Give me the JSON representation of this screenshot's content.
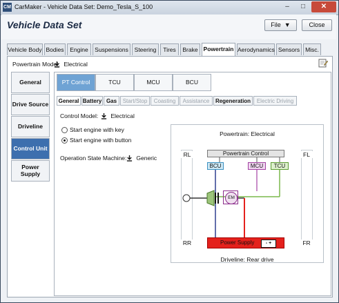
{
  "window": {
    "app_icon": "CM",
    "title": "CarMaker - Vehicle Data Set: Demo_Tesla_S_100",
    "minimize": "–",
    "maximize": "□",
    "close": "✕"
  },
  "header": {
    "title": "Vehicle Data Set",
    "file_label": "File",
    "close_label": "Close"
  },
  "main_tabs": [
    "Vehicle Body",
    "Bodies",
    "Engine",
    "Suspensions",
    "Steering",
    "Tires",
    "Brake",
    "Powertrain",
    "Aerodynamics",
    "Sensors",
    "Misc."
  ],
  "active_main_tab": "Powertrain",
  "powertrain": {
    "model_label": "Powertrain Model:",
    "model_value": "Electrical"
  },
  "sidebar": [
    {
      "label": "General"
    },
    {
      "label": "Drive Source"
    },
    {
      "label": "Driveline"
    },
    {
      "label": "Control Unit",
      "active": true
    },
    {
      "label": "Power Supply"
    }
  ],
  "control_tabs": [
    "PT Control",
    "TCU",
    "MCU",
    "BCU"
  ],
  "active_control_tab": "PT Control",
  "sub_tabs": [
    {
      "label": "General",
      "state": "active"
    },
    {
      "label": "Battery",
      "state": "bold"
    },
    {
      "label": "Gas",
      "state": "bold"
    },
    {
      "label": "Start/Stop",
      "state": "disabled"
    },
    {
      "label": "Coasting",
      "state": "disabled"
    },
    {
      "label": "Assistance",
      "state": "disabled"
    },
    {
      "label": "Regeneration",
      "state": "bold"
    },
    {
      "label": "Electric Driving",
      "state": "disabled"
    }
  ],
  "form": {
    "control_model_label": "Control Model:",
    "control_model_value": "Electrical",
    "start_key_label": "Start engine with key",
    "start_button_label": "Start engine with button",
    "selected_start": "button",
    "op_state_label": "Operation State Machine:",
    "op_state_value": "Generic"
  },
  "diagram": {
    "title": "Powertrain: Electrical",
    "footer": "Driveline: Rear drive",
    "wheels": [
      "RL",
      "FL",
      "RR",
      "FR"
    ],
    "controller": "Powertrain Control",
    "units": [
      "BCU",
      "MCU",
      "TCU"
    ],
    "motor": "EM",
    "power_supply": "Power Supply",
    "battery_symbol": "- +",
    "colors": {
      "bcu": "#6bb3d6",
      "mcu": "#b565b5",
      "tcu": "#7ab84a",
      "power_supply": "#e4211c",
      "driveshaft": "#2e3d8f"
    }
  }
}
